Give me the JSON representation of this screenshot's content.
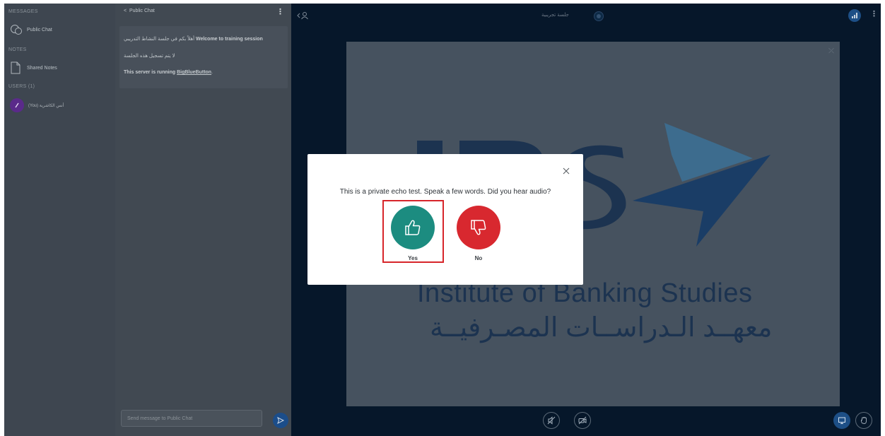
{
  "nav": {
    "messages_header": "MESSAGES",
    "public_chat": "Public Chat",
    "notes_header": "NOTES",
    "shared_notes": "Shared Notes",
    "users_header": "USERS (1)",
    "current_user": "(You) أنس الكاشرية"
  },
  "chat": {
    "title": "Public Chat",
    "messages": {
      "welcome": "Welcome to training session",
      "welcome_ar": "أهلاً بكم في جلسة النشاط التدريبي",
      "recording_notice": "لا يتم تسجيل هذه الجلسة",
      "server_prefix": "This server is running",
      "server_link": "BigBlueButton",
      "server_suffix": "."
    },
    "input_placeholder": "Send message to Public Chat"
  },
  "main": {
    "session_title": "جلسة تجريبية",
    "slide": {
      "institute_en": "Institute of Banking Studies",
      "institute_ar": "معهــد الـدراســات المصـرفيــة",
      "logo_letters": "IBS"
    }
  },
  "modal": {
    "question": "This is a private echo test. Speak a few words. Did you hear audio?",
    "yes_label": "Yes",
    "no_label": "No"
  },
  "colors": {
    "yes": "#1c8c80",
    "no": "#d8282f",
    "highlight": "#d7252a",
    "accent": "#1d4f86"
  },
  "icons": [
    "chat-icon",
    "notes-icon",
    "users-toggle-icon",
    "send-icon",
    "thumbs-up-icon",
    "thumbs-down-icon",
    "close-icon",
    "audio-icon",
    "video-icon",
    "presentation-icon",
    "hand-icon",
    "signal-icon"
  ]
}
